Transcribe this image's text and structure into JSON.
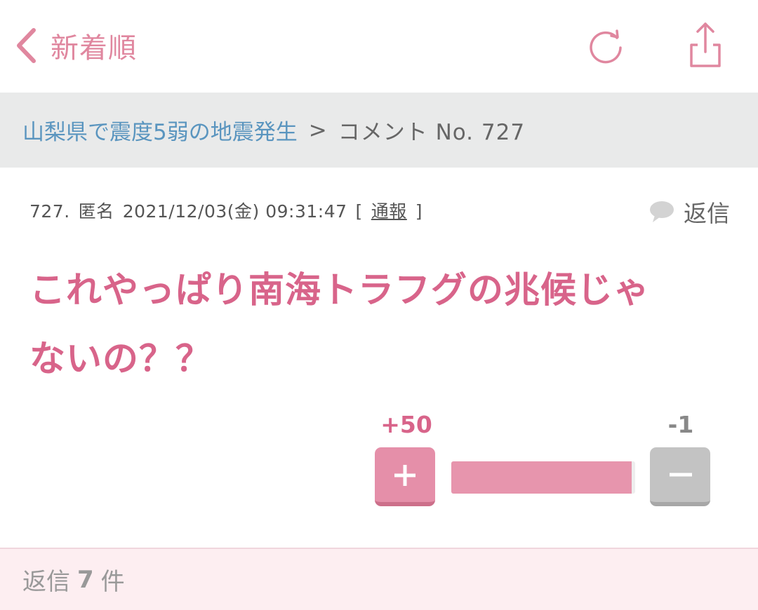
{
  "nav": {
    "back_label": "新着順",
    "icons": [
      "chevron-left-icon",
      "refresh-icon",
      "share-icon"
    ]
  },
  "breadcrumb": {
    "topic": "山梨県で震度5弱の地震発生",
    "separator": ">",
    "current": "コメント No. 727"
  },
  "comment": {
    "number": "727.",
    "author": "匿名",
    "datetime": "2021/12/03(金) 09:31:47",
    "report_open": "[",
    "report_label": "通報",
    "report_close": "]",
    "reply_label": "返信",
    "body_line1": "これやっぱり南海トラフグの兆候じゃ",
    "body_line2": "ないの？？"
  },
  "votes": {
    "plus_count": "+50",
    "minus_count": "-1",
    "plus_fraction": 0.98
  },
  "footer": {
    "prefix": "返信",
    "count": "7",
    "suffix": "件"
  },
  "colors": {
    "accent": "#d8648a",
    "link": "#5a95bf",
    "breadcrumb_bg": "#e9eaea",
    "footer_bg": "#fdeef1"
  }
}
